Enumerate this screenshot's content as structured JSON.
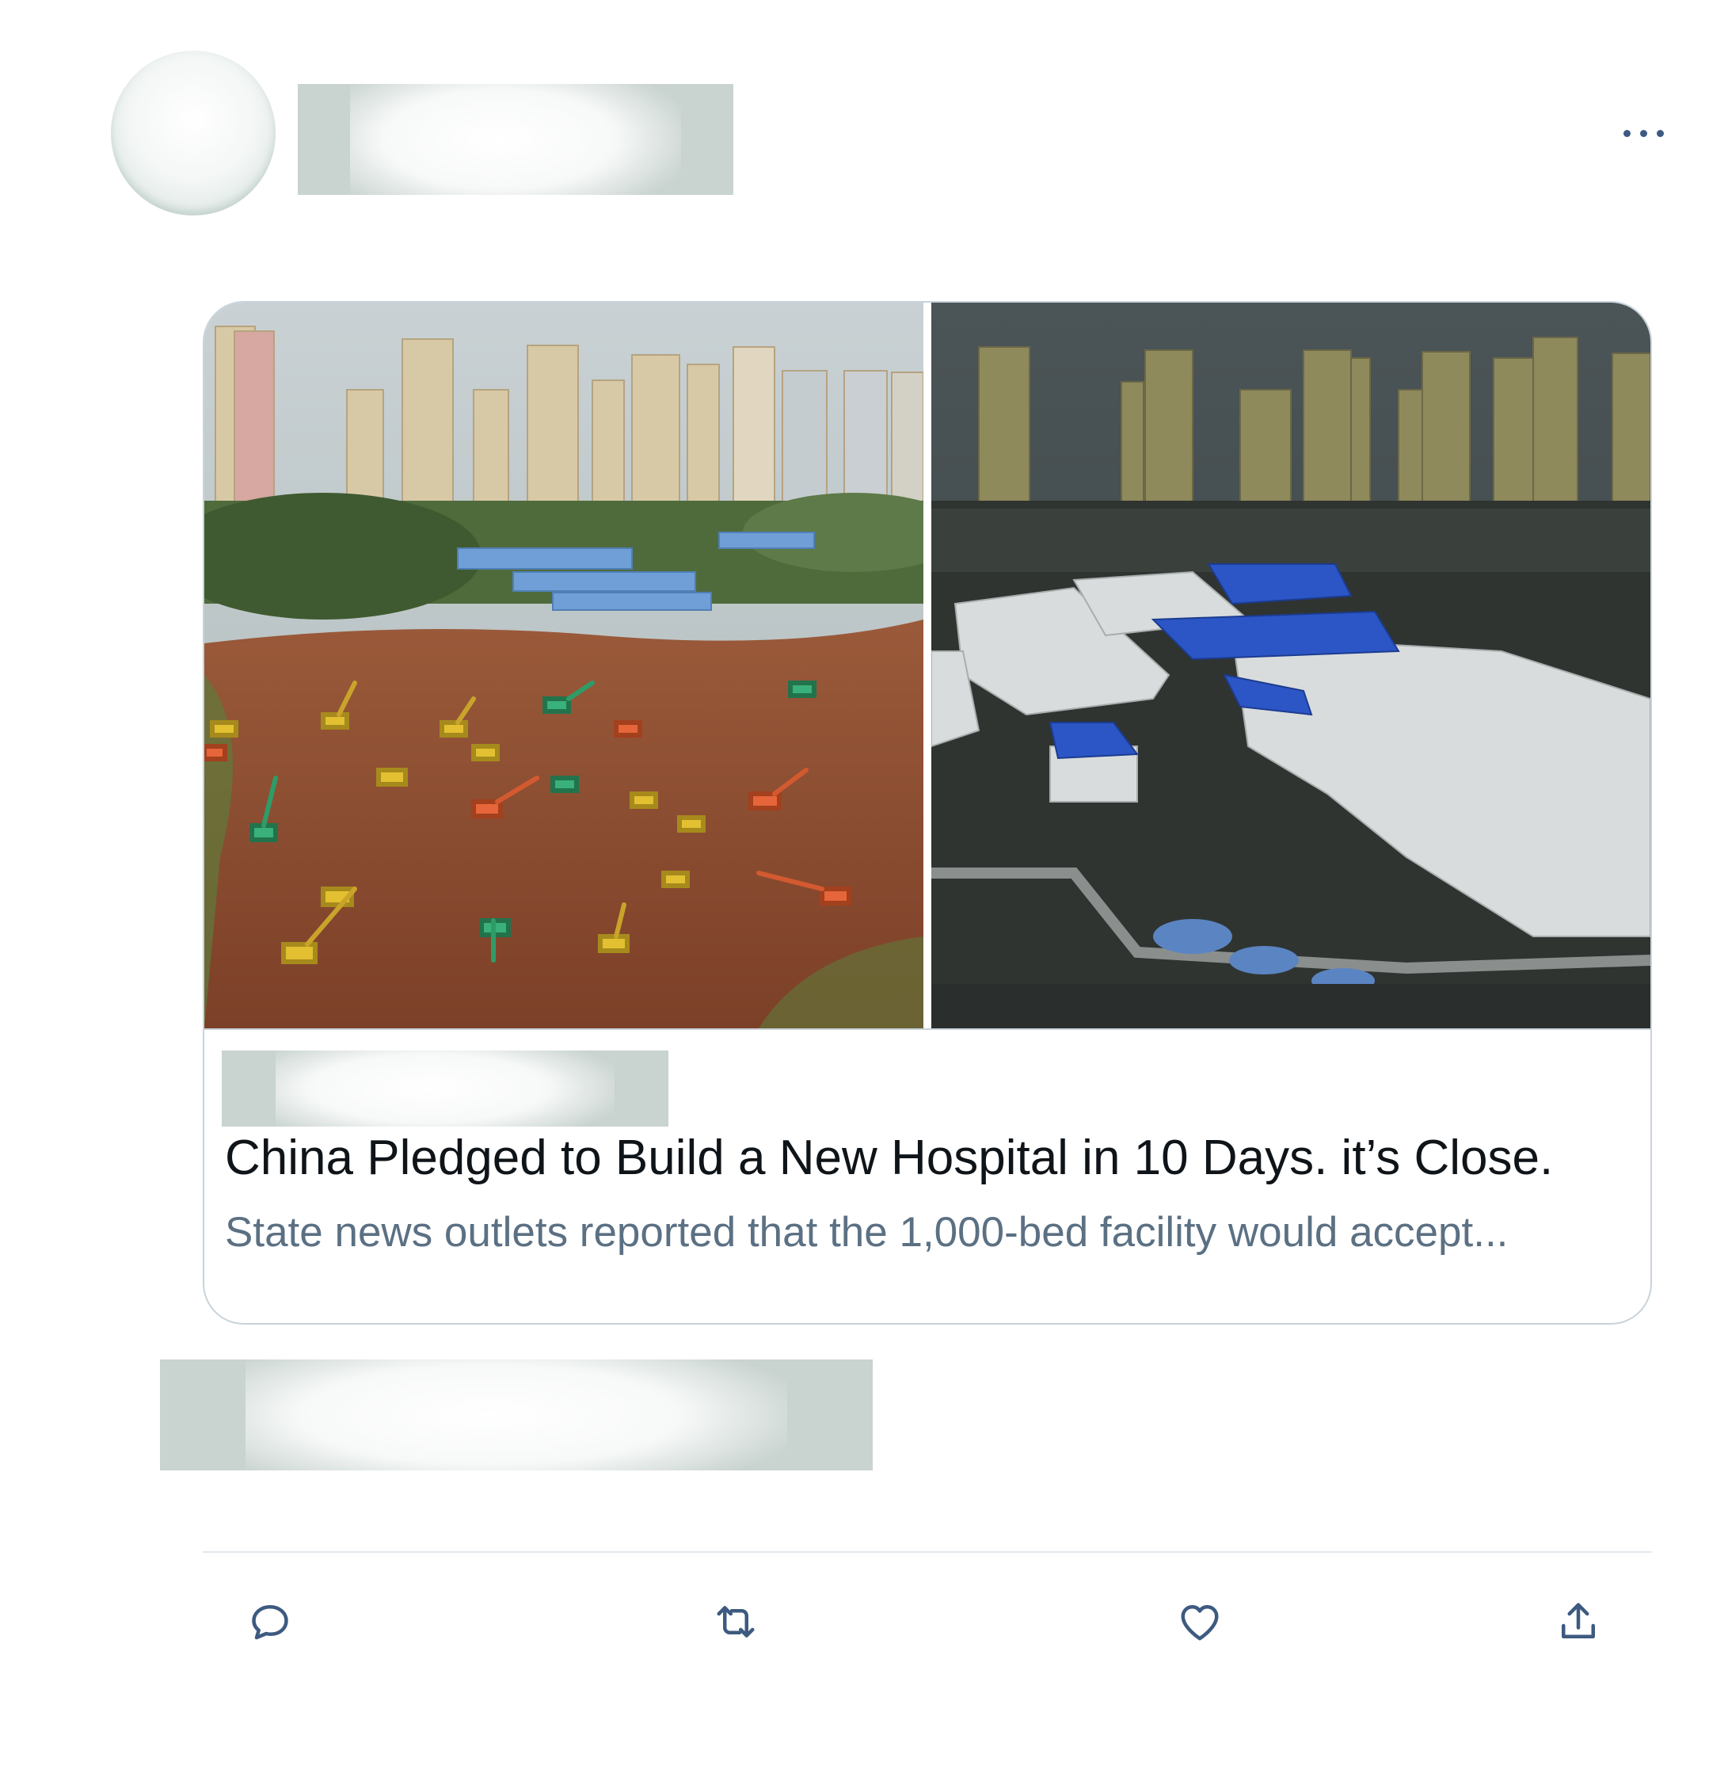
{
  "tweet": {
    "author": {
      "avatar": "avatar-redacted",
      "name_redacted": true
    },
    "more_icon": "more-horizontal-icon",
    "card": {
      "domain_redacted": true,
      "title": "China Pledged to Build a New Hospital in 10 Days. it’s Close.",
      "description": "State news outlets reported that the 1,000-bed facility would accept..."
    },
    "meta_redacted": true,
    "actions": [
      {
        "name": "reply",
        "icon": "reply-icon"
      },
      {
        "name": "retweet",
        "icon": "retweet-icon"
      },
      {
        "name": "like",
        "icon": "heart-icon"
      },
      {
        "name": "share",
        "icon": "share-icon"
      }
    ]
  },
  "colors": {
    "title_text": "#0f1419",
    "secondary_text": "#5b7083",
    "icon": "#3d5a80",
    "border": "#c8d3da",
    "redaction": "#c9d3cf"
  }
}
